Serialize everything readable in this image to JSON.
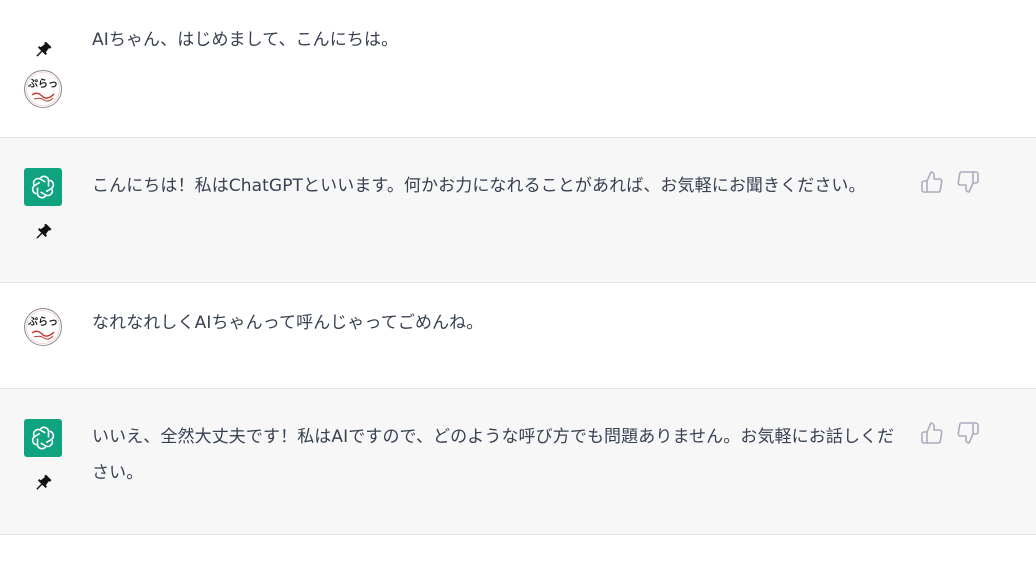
{
  "conversation": {
    "messages": [
      {
        "role": "user",
        "avatar_icon": "user-avatar-stamp-icon",
        "text": "AIちゃん、はじめまして、こんにちは。",
        "pinned": true
      },
      {
        "role": "assistant",
        "avatar_icon": "chatgpt-logo-icon",
        "text": "こんにちは！私はChatGPTといいます。何かお力になれることがあれば、お気軽にお聞きください。",
        "pinned": true
      },
      {
        "role": "user",
        "avatar_icon": "user-avatar-stamp-icon",
        "text": "なれなれしくAIちゃんって呼んじゃってごめんね。",
        "pinned": false
      },
      {
        "role": "assistant",
        "avatar_icon": "chatgpt-logo-icon",
        "text": "いいえ、全然大丈夫です！私はAIですので、どのような呼び方でも問題ありません。お気軽にお話しください。",
        "pinned": true
      }
    ]
  },
  "user_avatar": {
    "stamp_text": "ぷらっ"
  },
  "icons": {
    "pin": "pin-icon",
    "thumbs_up": "thumbs-up-icon",
    "thumbs_down": "thumbs-down-icon"
  },
  "colors": {
    "assistant_bg": "#f7f7f8",
    "brand_green": "#10a37f",
    "text": "#374151",
    "icon_gray": "#acacbe"
  }
}
